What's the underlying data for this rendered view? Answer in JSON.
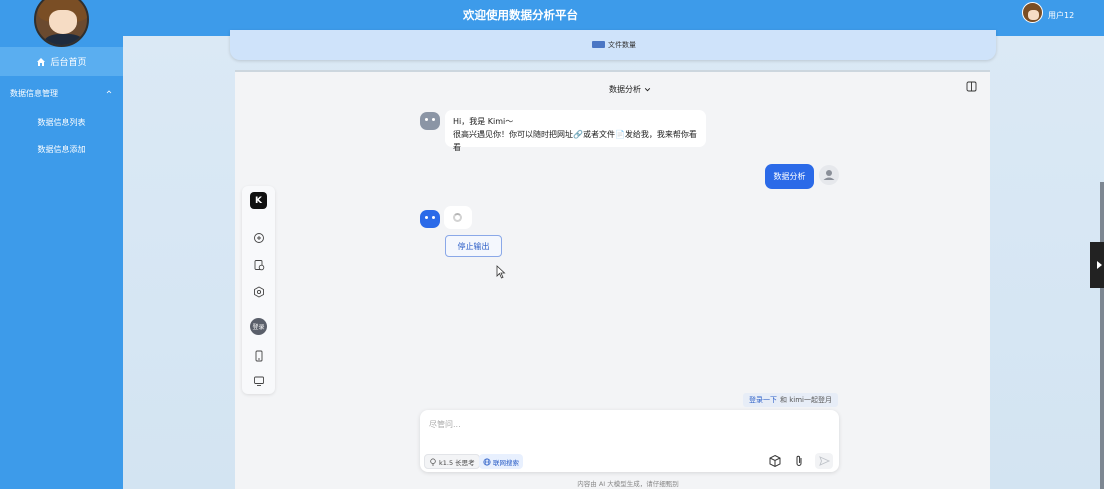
{
  "app": {
    "title": "欢迎使用数据分析平台",
    "username": "用户12"
  },
  "sidebar": {
    "home_label": "后台首页",
    "group_label": "数据信息管理",
    "items": [
      {
        "label": "数据信息列表"
      },
      {
        "label": "数据信息添加"
      }
    ]
  },
  "chart_legend": {
    "label": "文件数量",
    "color": "#4a76c4"
  },
  "kimi": {
    "model_label": "数据分析",
    "rail_logo": "K",
    "rail_login": "登录",
    "bot_greeting_line1": "Hi，我是 Kimi～",
    "bot_greeting_line2": "很高兴遇见你！你可以随时把网址🔗或者文件📄发给我，我来帮你看看",
    "user_message": "数据分析",
    "stop_label": "停止输出",
    "login_link": "登录一下",
    "login_suffix": "和 kimi一起登月",
    "input_placeholder": "尽管问...",
    "think_pill": "k1.5 长思考",
    "web_pill": "联网搜索",
    "disclaimer": "内容由 AI 大模型生成，请仔细甄别",
    "accent_color": "#2b6ae8"
  }
}
